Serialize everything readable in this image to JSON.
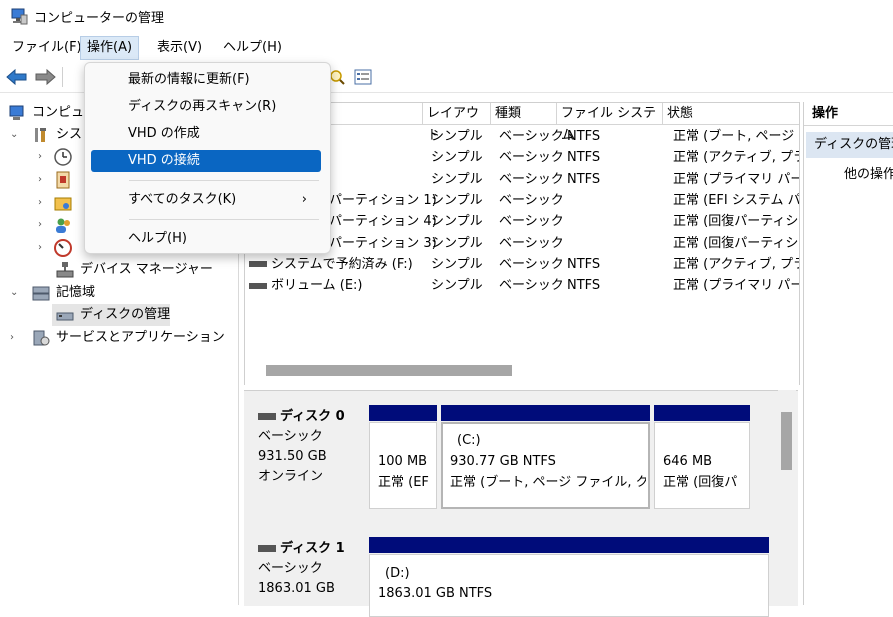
{
  "window": {
    "title": "コンピューターの管理"
  },
  "menubar": {
    "items": [
      "ファイル(F)",
      "操作(A)",
      "表示(V)",
      "ヘルプ(H)"
    ]
  },
  "dropdown": {
    "items": [
      "最新の情報に更新(F)",
      "ディスクの再スキャン(R)",
      "VHD の作成",
      "VHD の接続",
      "すべてのタスク(K)",
      "ヘルプ(H)"
    ],
    "submenu_arrow": "›"
  },
  "tree": {
    "root": "コンピュ",
    "system": "シス",
    "device_manager": "デバイス マネージャー",
    "storage": "記憶域",
    "disk_management": "ディスクの管理",
    "services": "サービスとアプリケーション"
  },
  "volumes": {
    "headers": [
      "レイアウト",
      "種類",
      "ファイル システム",
      "状態"
    ],
    "rows": [
      {
        "name": "",
        "layout": "シンプル",
        "type": "ベーシック",
        "fs": "NTFS",
        "status": "正常 (ブート, ページ フ"
      },
      {
        "name": "",
        "layout": "シンプル",
        "type": "ベーシック",
        "fs": "NTFS",
        "status": "正常 (アクティブ, プライ"
      },
      {
        "name": "",
        "layout": "シンプル",
        "type": "ベーシック",
        "fs": "NTFS",
        "status": "正常 (プライマリ パーテ"
      },
      {
        "name": "パーティション 1)",
        "layout": "シンプル",
        "type": "ベーシック",
        "fs": "",
        "status": "正常 (EFI システム パ"
      },
      {
        "name": "パーティション 4)",
        "layout": "シンプル",
        "type": "ベーシック",
        "fs": "",
        "status": "正常 (回復パーティシ"
      },
      {
        "name": "パーティション 3)",
        "layout": "シンプル",
        "type": "ベーシック",
        "fs": "",
        "status": "正常 (回復パーティシ"
      },
      {
        "name": "システムで予約済み (F:)",
        "layout": "シンプル",
        "type": "ベーシック",
        "fs": "NTFS",
        "status": "正常 (アクティブ, プライ"
      },
      {
        "name": "ボリューム (E:)",
        "layout": "シンプル",
        "type": "ベーシック",
        "fs": "NTFS",
        "status": "正常 (プライマリ パーテ"
      }
    ]
  },
  "disks": {
    "disk0": {
      "name": "ディスク 0",
      "type": "ベーシック",
      "size": "931.50 GB",
      "state": "オンライン",
      "p1": {
        "size": "100 MB",
        "status": "正常 (EF"
      },
      "p2": {
        "label": "(C:)",
        "size": "930.77 GB NTFS",
        "status": "正常 (ブート, ページ ファイル, クラッ:"
      },
      "p3": {
        "size": "646 MB",
        "status": "正常 (回復パ"
      }
    },
    "disk1": {
      "name": "ディスク 1",
      "type": "ベーシック",
      "size": "1863.01 GB",
      "p1": {
        "label": "(D:)",
        "size": "1863.01 GB NTFS"
      }
    }
  },
  "actions": {
    "header": "操作",
    "selected": "ディスクの管理",
    "other": "他の操作"
  },
  "colors": {
    "accent": "#0a66c2",
    "partition_bar": "#000c7a"
  }
}
